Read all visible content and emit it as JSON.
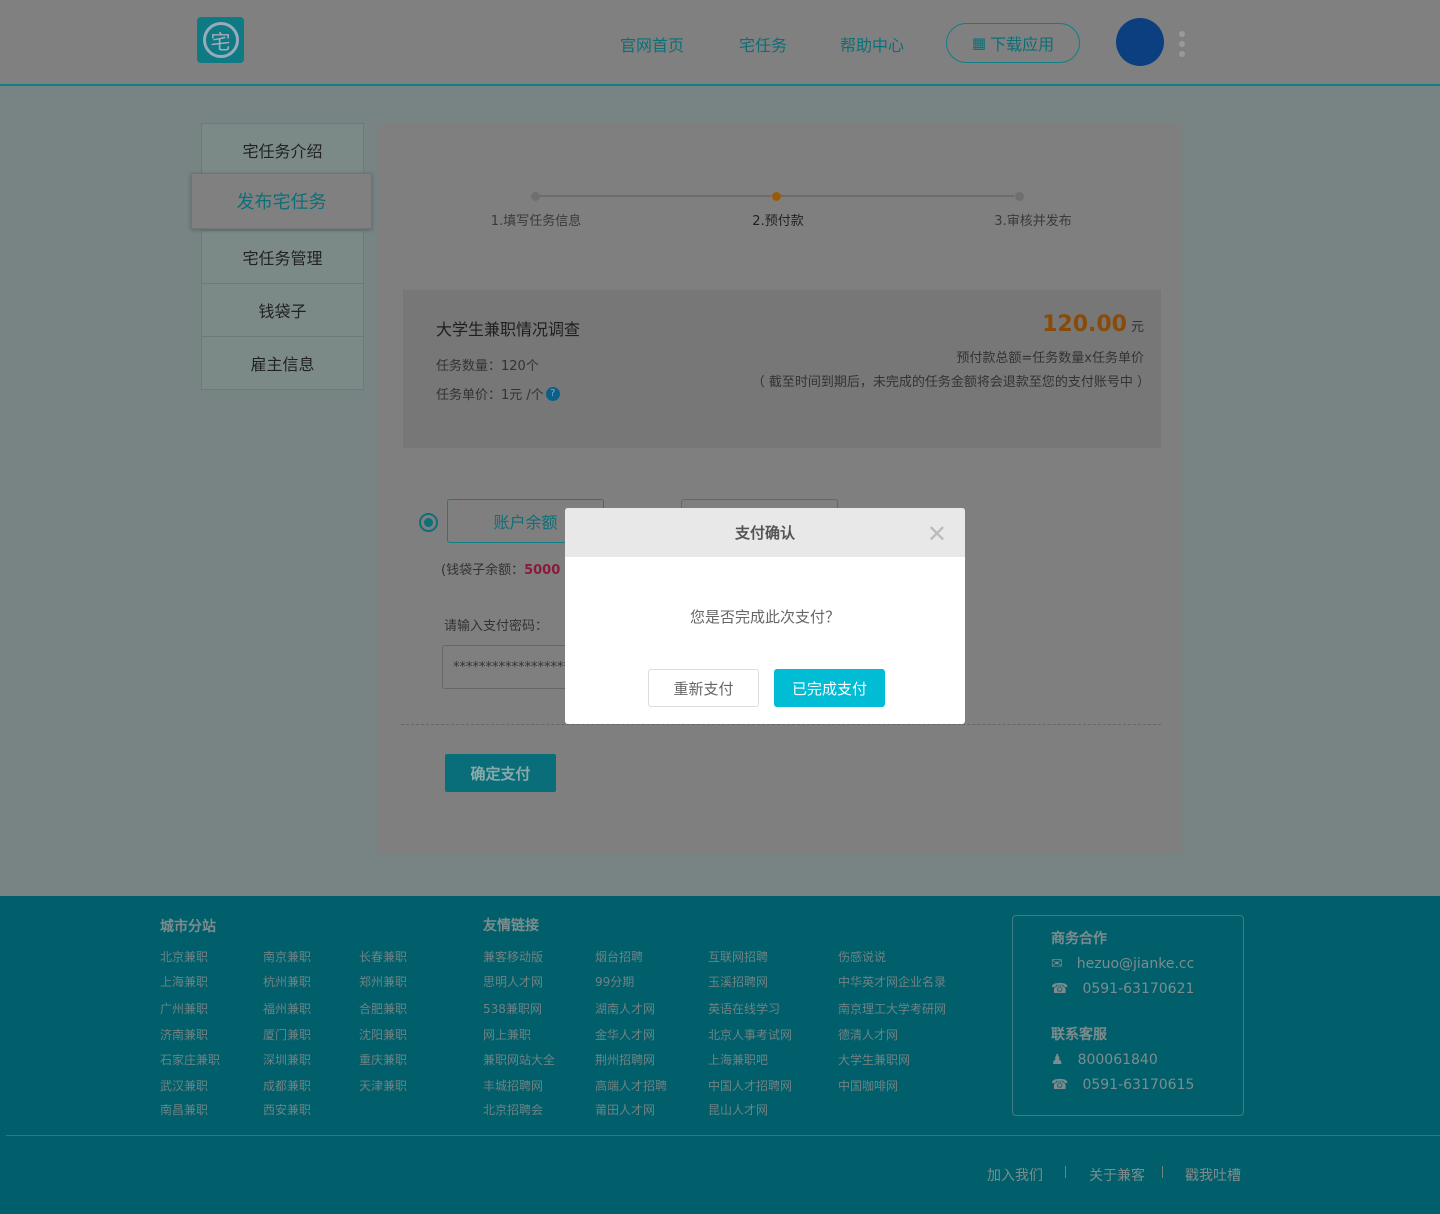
{
  "header": {
    "logo_char": "宅",
    "nav": [
      "官网首页",
      "宅任务",
      "帮助中心"
    ],
    "download_label": "下载应用"
  },
  "sidebar": {
    "items": [
      "宅任务介绍",
      "发布宅任务",
      "宅任务管理",
      "钱袋子",
      "雇主信息"
    ],
    "active": 1
  },
  "steps": {
    "items": [
      "1.填写任务信息",
      "2.预付款",
      "3.审核并发布"
    ],
    "current": 1
  },
  "task": {
    "title": "大学生兼职情况调查",
    "count_label": "任务数量：120个",
    "price_label": "任务单价：1元 /个",
    "amount": "120.00",
    "unit": "元",
    "formula": "预付款总额=任务数量x任务单价",
    "note": "（ 截至时间到期后，未完成的任务金额将会退款至您的支付账号中 ）"
  },
  "payment": {
    "method_balance": "账户余额",
    "wallet_prefix": "(钱袋子余额：",
    "wallet_amount": "5000",
    "password_label": "请输入支付密码：",
    "password_value": "******************",
    "confirm_label": "确定支付"
  },
  "modal": {
    "title": "支付确认",
    "message": "您是否完成此次支付？",
    "retry_label": "重新支付",
    "done_label": "已完成支付"
  },
  "footer": {
    "city_title": "城市分站",
    "cities": [
      [
        "北京兼职",
        "上海兼职",
        "广州兼职",
        "济南兼职",
        "石家庄兼职",
        "武汉兼职",
        "南昌兼职"
      ],
      [
        "南京兼职",
        "杭州兼职",
        "福州兼职",
        "厦门兼职",
        "深圳兼职",
        "成都兼职",
        "西安兼职"
      ],
      [
        "长春兼职",
        "郑州兼职",
        "合肥兼职",
        "沈阳兼职",
        "重庆兼职",
        "天津兼职"
      ]
    ],
    "links_title": "友情链接",
    "links": [
      [
        "兼客移动版",
        "思明人才网",
        "538兼职网",
        "网上兼职",
        "兼职网站大全",
        "丰城招聘网",
        "北京招聘会"
      ],
      [
        "烟台招聘",
        "99分期",
        "湖南人才网",
        "金华人才网",
        "荆州招聘网",
        "高端人才招聘",
        "莆田人才网"
      ],
      [
        "互联网招聘",
        "玉溪招聘网",
        "英语在线学习",
        "北京人事考试网",
        "上海兼职吧",
        "中国人才招聘网",
        "昆山人才网"
      ],
      [
        "伤感说说",
        "中华英才网企业名录",
        "南京理工大学考研网",
        "德清人才网",
        "大学生兼职网",
        "中国咖啡网"
      ]
    ],
    "business_title": "商务合作",
    "email": "hezuo@jianke.cc",
    "business_phone": "0591-63170621",
    "service_title": "联系客服",
    "qq": "800061840",
    "service_phone": "0591-63170615",
    "bottom_links": [
      "加入我们",
      "关于兼客",
      "戳我吐槽"
    ]
  }
}
